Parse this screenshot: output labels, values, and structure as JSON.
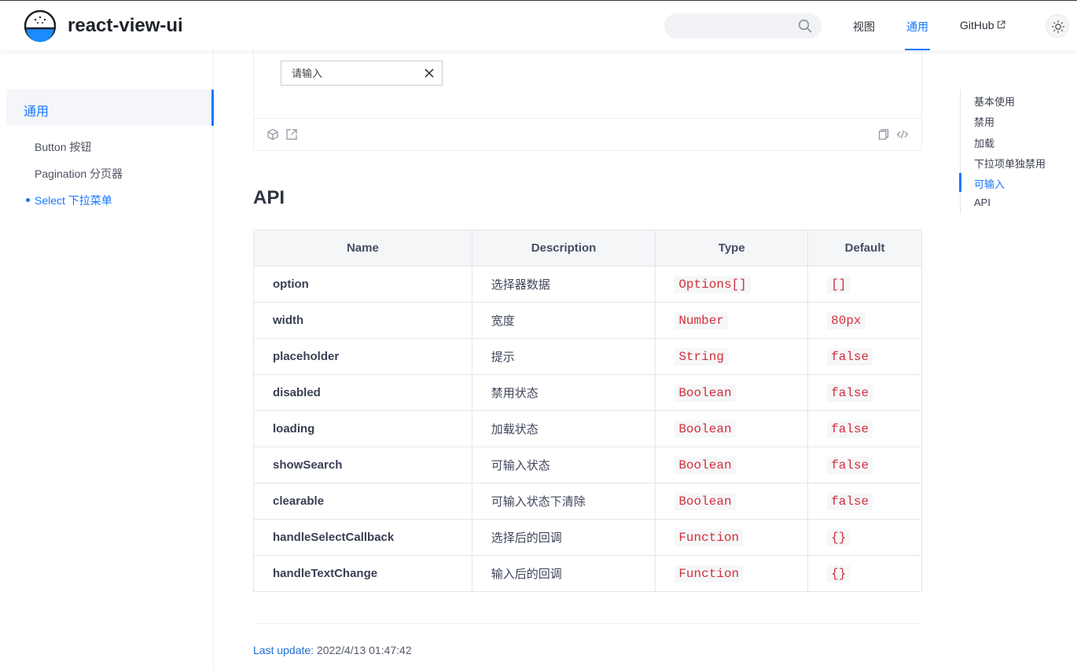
{
  "header": {
    "brand": "react-view-ui",
    "search_placeholder": "",
    "nav": [
      {
        "label": "视图",
        "active": false
      },
      {
        "label": "通用",
        "active": true
      },
      {
        "label": "GitHub",
        "active": false,
        "external": true
      }
    ]
  },
  "sidebar": {
    "group_title": "通用",
    "items": [
      {
        "label": "Button 按钮",
        "active": false
      },
      {
        "label": "Pagination 分页器",
        "active": false
      },
      {
        "label": "Select 下拉菜单",
        "active": true
      }
    ]
  },
  "demo": {
    "input_placeholder": "请输入"
  },
  "api": {
    "title": "API",
    "columns": [
      "Name",
      "Description",
      "Type",
      "Default"
    ],
    "rows": [
      {
        "name": "option",
        "description": "选择器数据",
        "type": "Options[]",
        "default": "[]"
      },
      {
        "name": "width",
        "description": "宽度",
        "type": "Number",
        "default": "80px"
      },
      {
        "name": "placeholder",
        "description": "提示",
        "type": "String",
        "default": "false"
      },
      {
        "name": "disabled",
        "description": "禁用状态",
        "type": "Boolean",
        "default": "false"
      },
      {
        "name": "loading",
        "description": "加载状态",
        "type": "Boolean",
        "default": "false"
      },
      {
        "name": "showSearch",
        "description": "可输入状态",
        "type": "Boolean",
        "default": "false"
      },
      {
        "name": "clearable",
        "description": "可输入状态下清除",
        "type": "Boolean",
        "default": "false"
      },
      {
        "name": "handleSelectCallback",
        "description": "选择后的回调",
        "type": "Function",
        "default": "{}"
      },
      {
        "name": "handleTextChange",
        "description": "输入后的回调",
        "type": "Function",
        "default": "{}"
      }
    ]
  },
  "footer": {
    "last_update_label": "Last update:",
    "last_update_value": "2022/4/13 01:47:42"
  },
  "toc": {
    "items": [
      {
        "label": "基本使用",
        "active": false
      },
      {
        "label": "禁用",
        "active": false
      },
      {
        "label": "加载",
        "active": false
      },
      {
        "label": "下拉项单独禁用",
        "active": false
      },
      {
        "label": "可输入",
        "active": true
      },
      {
        "label": "API",
        "active": false
      }
    ]
  },
  "colors": {
    "accent": "#1677ff",
    "code_text": "#d1303c",
    "logo_water": "#1a8cff"
  }
}
